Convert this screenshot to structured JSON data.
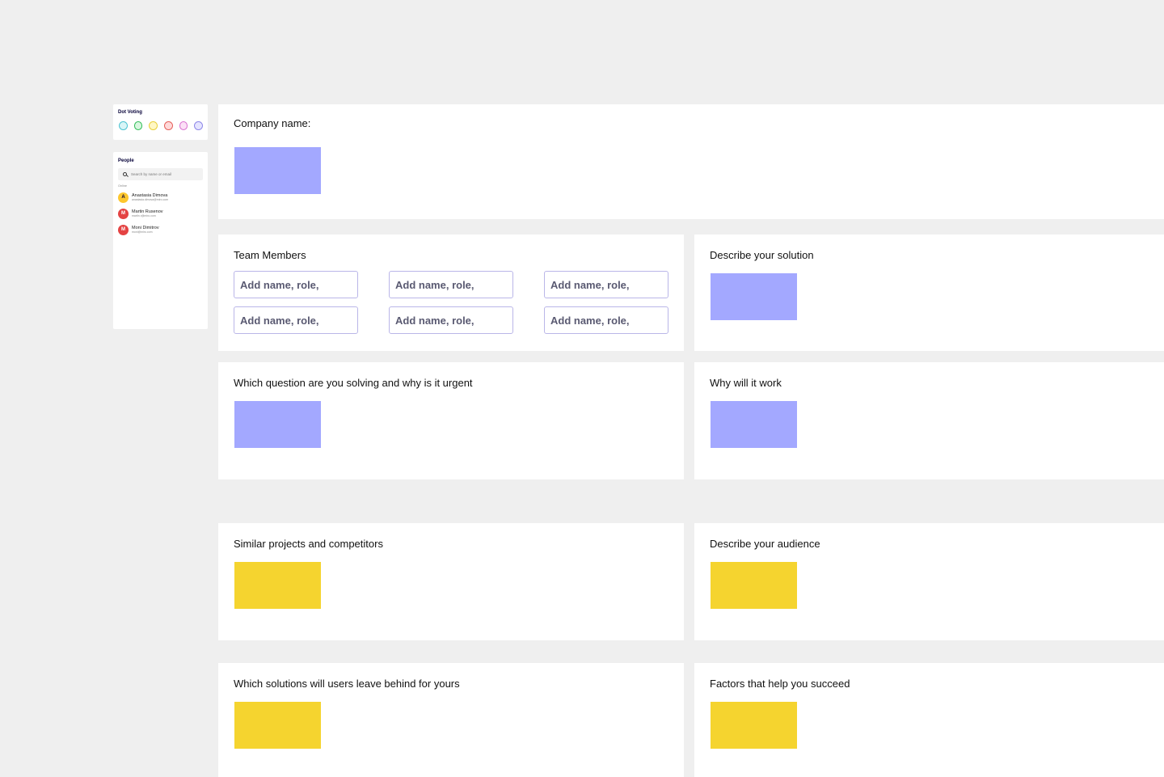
{
  "dot_voting": {
    "title": "Dot Voting",
    "dots": [
      {
        "fill": "#d9f5f7",
        "border": "#4cc3d1"
      },
      {
        "fill": "#d8f6df",
        "border": "#2dbb55"
      },
      {
        "fill": "#fff7c4",
        "border": "#e8cf3a"
      },
      {
        "fill": "#ffd9d9",
        "border": "#e5615b"
      },
      {
        "fill": "#fbe0f6",
        "border": "#d86fd0"
      },
      {
        "fill": "#e5e4ff",
        "border": "#8e88e8"
      }
    ]
  },
  "people": {
    "title": "People",
    "search_placeholder": "Search by name or email",
    "online_label": "Online",
    "members": [
      {
        "initial": "A",
        "name": "Anastasia Dimova",
        "email": "anastasia.dimova@miro.com",
        "bg": "#fdc72e",
        "fg": "#050038"
      },
      {
        "initial": "M",
        "name": "Martin Rusenov",
        "email": "martin.r@miro.com",
        "bg": "#e44343",
        "fg": "#ffffff"
      },
      {
        "initial": "M",
        "name": "Moni Dimitrov",
        "email": "moni@miro.com",
        "bg": "#e44343",
        "fg": "#ffffff"
      }
    ]
  },
  "colors": {
    "sticky_purple": "#a3a8ff",
    "sticky_yellow": "#f5d42f"
  },
  "frames": {
    "company": {
      "title": "Company name:"
    },
    "team": {
      "title": "Team Members",
      "placeholders": [
        "Add name, role,",
        "Add name, role,",
        "Add name, role,",
        "Add name, role,",
        "Add name, role,",
        "Add name, role,"
      ]
    },
    "solution": {
      "title": "Describe your solution"
    },
    "question": {
      "title": "Which question are you solving and why is it urgent"
    },
    "why_work": {
      "title": "Why will it work"
    },
    "similar": {
      "title": "Similar projects and competitors"
    },
    "audience": {
      "title": "Describe your audience"
    },
    "leave_behind": {
      "title": "Which solutions will users leave behind for yours"
    },
    "factors": {
      "title": "Factors that help you succeed"
    }
  }
}
